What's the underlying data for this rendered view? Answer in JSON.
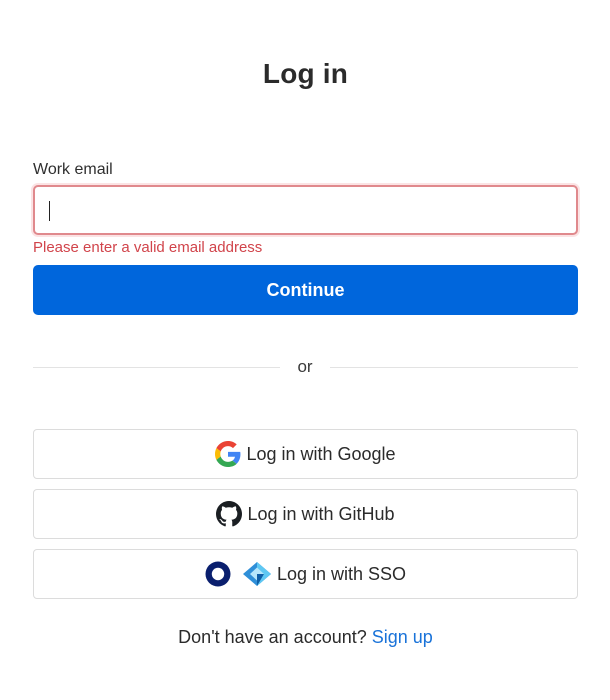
{
  "page": {
    "title": "Log in"
  },
  "form": {
    "email_label": "Work email",
    "email_value": "",
    "email_placeholder": "",
    "error_message": "Please enter a valid email address",
    "continue_label": "Continue"
  },
  "divider": {
    "text": "or"
  },
  "social": {
    "google_label": "Log in with Google",
    "github_label": "Log in with GitHub",
    "sso_label": "Log in with SSO"
  },
  "footer": {
    "prompt": "Don't have an account?",
    "signup_label": "Sign up"
  },
  "colors": {
    "primary": "#0066dc",
    "error": "#d1444b",
    "link": "#1a73d9"
  },
  "icons": [
    "google-icon",
    "github-icon",
    "okta-icon",
    "azure-icon"
  ]
}
